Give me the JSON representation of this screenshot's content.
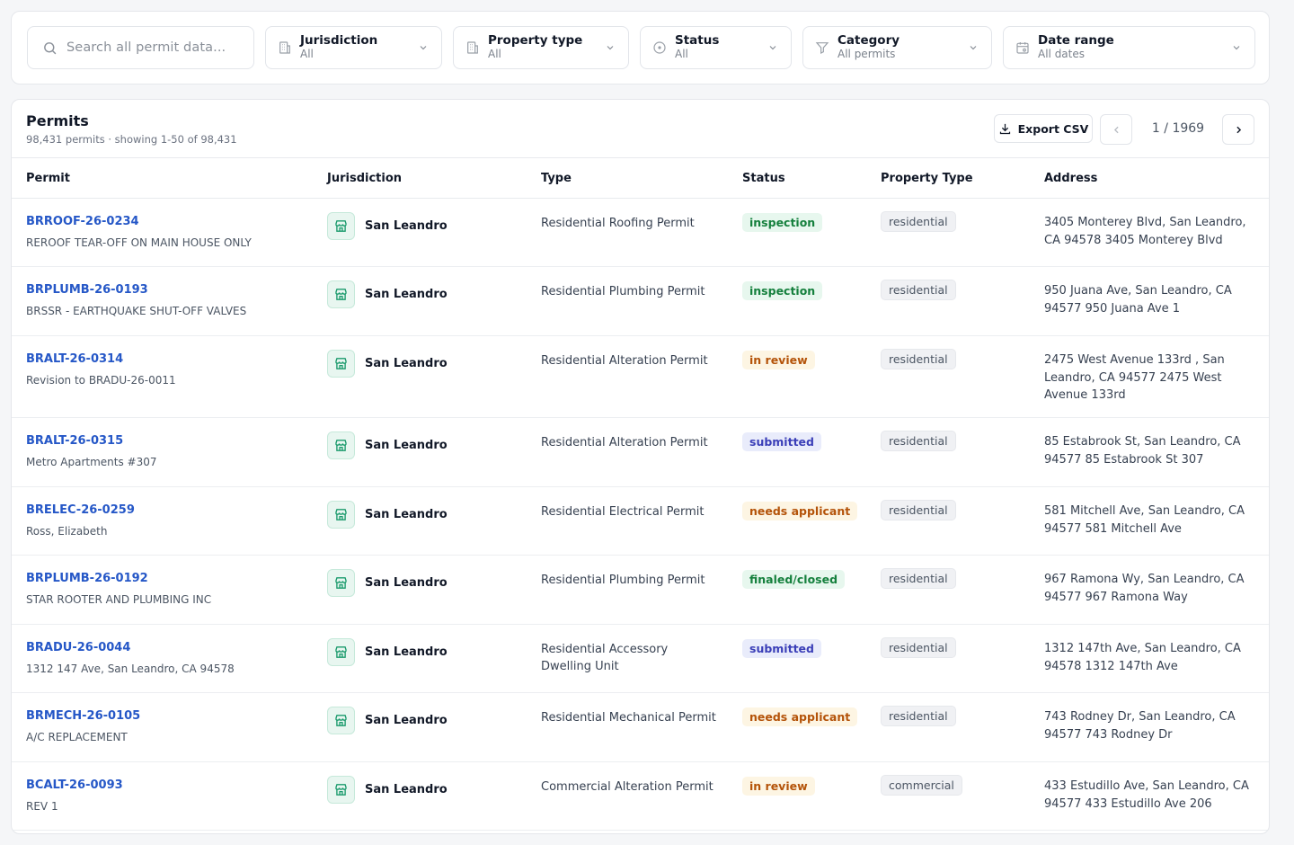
{
  "search": {
    "placeholder": "Search all permit data..."
  },
  "filters": [
    {
      "id": "jurisdiction",
      "label": "Jurisdiction",
      "value": "All",
      "icon": "building-icon"
    },
    {
      "id": "property-type",
      "label": "Property type",
      "value": "All",
      "icon": "building-icon"
    },
    {
      "id": "status",
      "label": "Status",
      "value": "All",
      "icon": "circle-dot-icon"
    },
    {
      "id": "category",
      "label": "Category",
      "value": "All permits",
      "icon": "funnel-icon"
    },
    {
      "id": "date-range",
      "label": "Date range",
      "value": "All dates",
      "icon": "calendar-icon"
    }
  ],
  "panel": {
    "title": "Permits",
    "subtitle": "98,431 permits · showing 1-50 of 98,431",
    "export_label": "Export CSV",
    "page_text": "1 / 1969"
  },
  "columns": {
    "permit": "Permit",
    "jurisdiction": "Jurisdiction",
    "type": "Type",
    "status": "Status",
    "property_type": "Property Type",
    "address": "Address"
  },
  "status_colors": {
    "green": "#15803d",
    "amber": "#b45309",
    "indigo": "#3b3fb8"
  },
  "rows": [
    {
      "id": "BRROOF-26-0234",
      "desc": "REROOF TEAR-OFF ON MAIN HOUSE ONLY",
      "jurisdiction": "San Leandro",
      "type": "Residential Roofing Permit",
      "status": "inspection",
      "status_tone": "green",
      "property_type": "residential",
      "address": "3405 Monterey Blvd, San Leandro, CA 94578 3405 Monterey Blvd"
    },
    {
      "id": "BRPLUMB-26-0193",
      "desc": "BRSSR - EARTHQUAKE SHUT-OFF VALVES",
      "jurisdiction": "San Leandro",
      "type": "Residential Plumbing Permit",
      "status": "inspection",
      "status_tone": "green",
      "property_type": "residential",
      "address": "950 Juana Ave, San Leandro, CA 94577 950 Juana Ave 1"
    },
    {
      "id": "BRALT-26-0314",
      "desc": "Revision to BRADU-26-0011",
      "jurisdiction": "San Leandro",
      "type": "Residential Alteration Permit",
      "status": "in review",
      "status_tone": "amber",
      "property_type": "residential",
      "address": "2475 West Avenue 133rd , San Leandro, CA 94577 2475 West Avenue 133rd"
    },
    {
      "id": "BRALT-26-0315",
      "desc": "Metro Apartments #307",
      "jurisdiction": "San Leandro",
      "type": "Residential Alteration Permit",
      "status": "submitted",
      "status_tone": "indigo",
      "property_type": "residential",
      "address": "85 Estabrook St, San Leandro, CA 94577 85 Estabrook St 307"
    },
    {
      "id": "BRELEC-26-0259",
      "desc": "Ross, Elizabeth",
      "jurisdiction": "San Leandro",
      "type": "Residential Electrical Permit",
      "status": "needs applicant",
      "status_tone": "amber",
      "property_type": "residential",
      "address": "581 Mitchell Ave, San Leandro, CA 94577 581 Mitchell Ave"
    },
    {
      "id": "BRPLUMB-26-0192",
      "desc": "STAR ROOTER AND PLUMBING INC",
      "jurisdiction": "San Leandro",
      "type": "Residential Plumbing Permit",
      "status": "finaled/closed",
      "status_tone": "green",
      "property_type": "residential",
      "address": "967 Ramona Wy, San Leandro, CA 94577 967 Ramona Way"
    },
    {
      "id": "BRADU-26-0044",
      "desc": "1312 147 Ave, San Leandro, CA 94578",
      "jurisdiction": "San Leandro",
      "type": "Residential Accessory Dwelling Unit",
      "status": "submitted",
      "status_tone": "indigo",
      "property_type": "residential",
      "address": "1312 147th Ave, San Leandro, CA 94578 1312 147th Ave"
    },
    {
      "id": "BRMECH-26-0105",
      "desc": "A/C REPLACEMENT",
      "jurisdiction": "San Leandro",
      "type": "Residential Mechanical Permit",
      "status": "needs applicant",
      "status_tone": "amber",
      "property_type": "residential",
      "address": "743 Rodney Dr, San Leandro, CA 94577 743 Rodney Dr"
    },
    {
      "id": "BCALT-26-0093",
      "desc": "REV 1",
      "jurisdiction": "San Leandro",
      "type": "Commercial Alteration Permit",
      "status": "in review",
      "status_tone": "amber",
      "property_type": "commercial",
      "address": "433 Estudillo Ave, San Leandro, CA 94577 433 Estudillo Ave 206"
    }
  ]
}
